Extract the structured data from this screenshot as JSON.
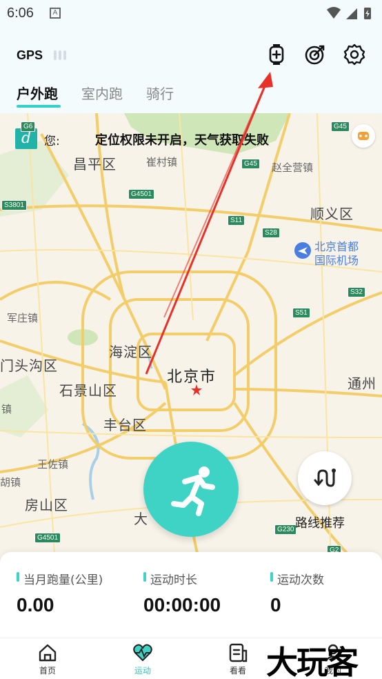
{
  "status_bar": {
    "time": "6:06",
    "notification_letter": "A"
  },
  "header": {
    "gps_label": "GPS",
    "icons": [
      "add-watch-icon",
      "target-icon",
      "gear-icon"
    ],
    "tabs": [
      {
        "label": "户外跑",
        "active": true
      },
      {
        "label": "室内跑",
        "active": false
      },
      {
        "label": "骑行",
        "active": false
      }
    ]
  },
  "map": {
    "weather": {
      "icon_letter": "d",
      "prefix": "您:",
      "message": "定位权限未开启，天气获取失败"
    },
    "places": {
      "changping": "昌平区",
      "cuicun": "崔村镇",
      "zhaoquanying": "赵全营镇",
      "shunyi": "顺义区",
      "airport_line1": "北京首都",
      "airport_line2": "国际机场",
      "junzhuang": "军庄镇",
      "haidian": "海淀区",
      "mentougou": "门头沟区",
      "beijing": "北京市",
      "shijingshan": "石景山区",
      "tongzhou": "通州",
      "zhen_left": "镇",
      "fengtai": "丰台区",
      "wangzuo": "王佐镇",
      "hu_zhen": "胡镇",
      "fangshan": "房山区",
      "daxing_partial": "大"
    },
    "shields": [
      "G6",
      "G45",
      "G45",
      "G4501",
      "S3801",
      "S11",
      "S28",
      "S32",
      "S51",
      "G4501",
      "G230",
      "G2"
    ],
    "route_label": "路线推荐"
  },
  "stats": [
    {
      "label": "当月跑量(公里)",
      "value": "0.00"
    },
    {
      "label": "运动时长",
      "value": "00:00:00"
    },
    {
      "label": "运动次数",
      "value": "0"
    }
  ],
  "nav": [
    {
      "label": "首页",
      "icon": "home-icon"
    },
    {
      "label": "运动",
      "icon": "heartbeat-icon",
      "active": true
    },
    {
      "label": "看看",
      "icon": "reading-icon"
    },
    {
      "label": "我的",
      "icon": "profile-icon"
    }
  ],
  "watermark": "大玩客",
  "colors": {
    "accent": "#3fd3c6",
    "arrow": "#e8302a",
    "highway": "#2b8a5c"
  }
}
